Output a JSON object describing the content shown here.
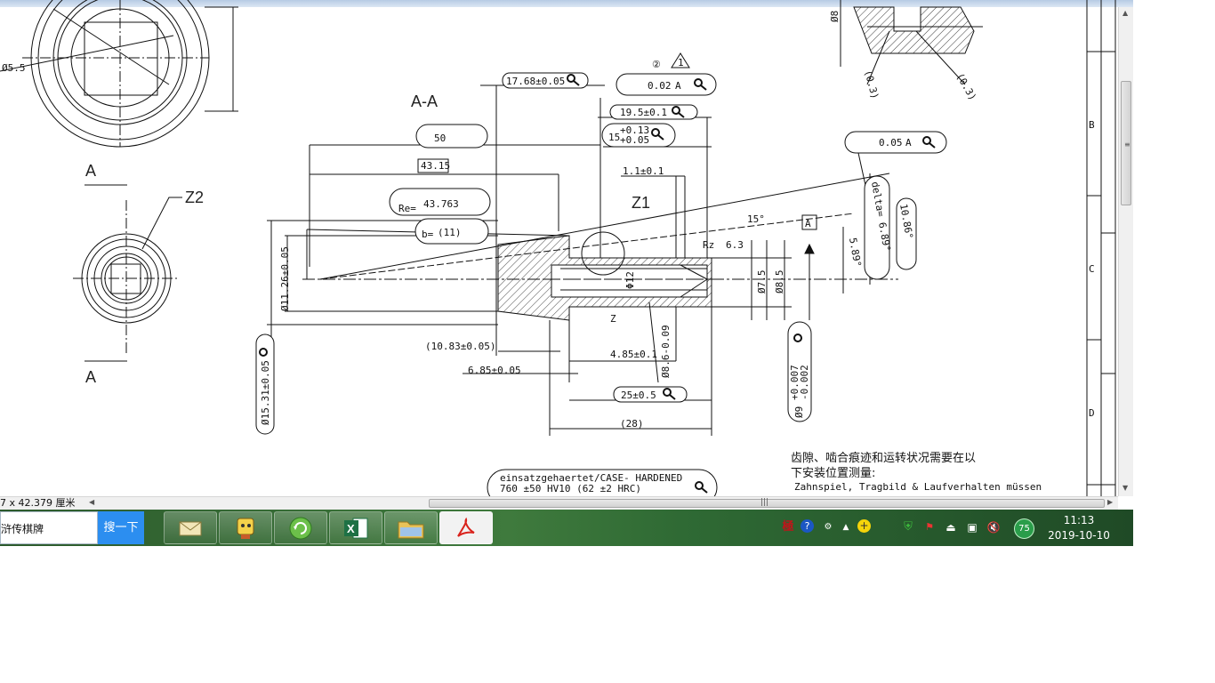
{
  "drawing": {
    "section_label": "A-A",
    "view_arrow_top": "A",
    "view_arrow_bottom": "A",
    "detail_z2": "Z2",
    "detail_z1": "Z1",
    "dia_5_5": "Ø5.5",
    "dims": {
      "d17_68": "17.68±0.05",
      "flatness_symbol": "②",
      "note_triangle": "1",
      "runout_02_value": "0.02",
      "runout_02_datum": "A",
      "d19_5": "19.5±0.1",
      "box_50": "50",
      "d15_tol": "15",
      "d15_upper": "+0.13",
      "d15_lower": "+0.05",
      "d43_15": "43.15",
      "d1_1": "1.1±0.1",
      "re_label": "Re=",
      "re_value": "43.763",
      "b_label": "b=",
      "b_value": "(11)",
      "angle_15": "15°",
      "datum_a": "A",
      "rz_label": "Rz",
      "rz_value": "6.3",
      "d11_26": "Ø11.26±0.05",
      "d12": "Φ12",
      "d7_5": "Ø7.5",
      "d8_5": "Ø8.5",
      "runout_05_value": "0.05",
      "runout_05_datum": "A",
      "delta_label": "delta= 6.89°",
      "angle_10_86": "10.86°",
      "angle_5_89": "5.89°",
      "z_label": "Z",
      "d10_83": "(10.83±0.05)",
      "d4_85": "4.85±0.1",
      "d8_6": "Ø8.6-0.09",
      "d6_85": "6.85±0.05",
      "d15_31": "Ø15.31±0.05",
      "d25": "25±0.5",
      "d28": "(28)",
      "d9": "Ø9",
      "d9_upper": "+0.007",
      "d9_lower": "-0.002",
      "d8_top": "Ø8",
      "d0_3a": "(0.3)",
      "d0_3b": "(0.3)"
    },
    "hardening_note_line1": "einsatzgehaertet/CASE- HARDENED",
    "hardening_note_line2": "760 ±50 HV10 (62 ±2 HRC)",
    "chinese_note_line1": "齿隙、啮合痕迹和运转状况需要在以",
    "chinese_note_line2": "下安装位置测量:",
    "german_note": "Zahnspiel, Tragbild & Laufverhalten müssen",
    "zones": [
      "B",
      "C",
      "D"
    ]
  },
  "status": {
    "page_size": "7 x 42.379 厘米"
  },
  "taskbar": {
    "search_text": "浒传棋牌",
    "search_button": "搜一下",
    "apps": [
      {
        "name": "mail-app",
        "icon": "envelope-icon"
      },
      {
        "name": "qq-game-app",
        "icon": "character-icon"
      },
      {
        "name": "browser-app",
        "icon": "refresh-globe-icon"
      },
      {
        "name": "excel-app",
        "icon": "excel-icon",
        "label": "X"
      },
      {
        "name": "explorer-app",
        "icon": "folder-icon"
      },
      {
        "name": "pdf-app",
        "icon": "pdf-icon"
      }
    ],
    "tray": {
      "ime_char": "極",
      "badge_value": "75",
      "time": "11:13",
      "date": "2019-10-10"
    }
  },
  "colors": {
    "taskbar": "#3f7a3d",
    "search_button": "#2c8ef0",
    "excel_green": "#1e7145",
    "pdf_red": "#d9231c"
  }
}
